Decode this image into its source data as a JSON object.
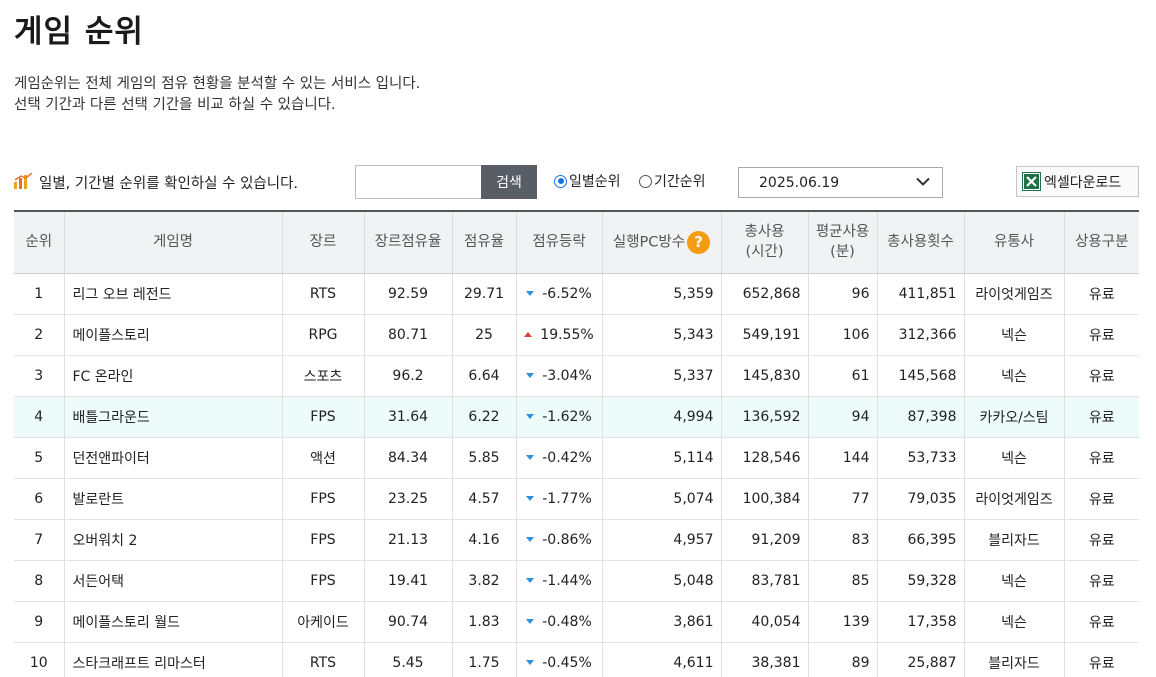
{
  "page": {
    "title": "게임 순위",
    "desc_line1": "게임순위는 전체 게임의 점유 현황을 분석할 수 있는 서비스 입니다.",
    "desc_line2": "선택 기간과 다른 선택 기간을 비교 하실 수 있습니다."
  },
  "toolbar": {
    "info_text": "일별, 기간별 순위를 확인하실 수 있습니다.",
    "search_value": "",
    "search_button": "검색",
    "radio_daily": "일별순위",
    "radio_period": "기간순위",
    "radio_selected": "daily",
    "date_value": "2025.06.19",
    "excel_button": "엑셀다운로드"
  },
  "colors": {
    "accent_blue": "#1a73e8",
    "up_red": "#e03a3a",
    "down_blue": "#2f8fd8",
    "help_orange": "#f39c12",
    "highlight_row": "#eefbfb"
  },
  "table": {
    "headers": {
      "rank": "순위",
      "name": "게임명",
      "genre": "장르",
      "genre_share": "장르점유율",
      "share": "점유율",
      "share_change": "점유등락",
      "pc_count": "실행PC방수",
      "total_usage_1": "총사용",
      "total_usage_2": "(시간)",
      "avg_usage_1": "평균사용",
      "avg_usage_2": "(분)",
      "total_count": "총사용횟수",
      "publisher": "유통사",
      "commercial": "상용구분"
    },
    "help_icon": "?",
    "rows": [
      {
        "rank": "1",
        "name": "리그 오브 레전드",
        "genre": "RTS",
        "genre_share": "92.59",
        "share": "29.71",
        "dir": "down",
        "change": "-6.52%",
        "pc": "5,359",
        "total": "652,868",
        "avg": "96",
        "count": "411,851",
        "publisher": "라이엇게임즈",
        "commercial": "유료"
      },
      {
        "rank": "2",
        "name": "메이플스토리",
        "genre": "RPG",
        "genre_share": "80.71",
        "share": "25",
        "dir": "up",
        "change": "19.55%",
        "pc": "5,343",
        "total": "549,191",
        "avg": "106",
        "count": "312,366",
        "publisher": "넥슨",
        "commercial": "유료"
      },
      {
        "rank": "3",
        "name": "FC 온라인",
        "genre": "스포츠",
        "genre_share": "96.2",
        "share": "6.64",
        "dir": "down",
        "change": "-3.04%",
        "pc": "5,337",
        "total": "145,830",
        "avg": "61",
        "count": "145,568",
        "publisher": "넥슨",
        "commercial": "유료"
      },
      {
        "rank": "4",
        "name": "배틀그라운드",
        "genre": "FPS",
        "genre_share": "31.64",
        "share": "6.22",
        "dir": "down",
        "change": "-1.62%",
        "pc": "4,994",
        "total": "136,592",
        "avg": "94",
        "count": "87,398",
        "publisher": "카카오/스팀",
        "commercial": "유료",
        "highlight": true
      },
      {
        "rank": "5",
        "name": "던전앤파이터",
        "genre": "액션",
        "genre_share": "84.34",
        "share": "5.85",
        "dir": "down",
        "change": "-0.42%",
        "pc": "5,114",
        "total": "128,546",
        "avg": "144",
        "count": "53,733",
        "publisher": "넥슨",
        "commercial": "유료"
      },
      {
        "rank": "6",
        "name": "발로란트",
        "genre": "FPS",
        "genre_share": "23.25",
        "share": "4.57",
        "dir": "down",
        "change": "-1.77%",
        "pc": "5,074",
        "total": "100,384",
        "avg": "77",
        "count": "79,035",
        "publisher": "라이엇게임즈",
        "commercial": "유료"
      },
      {
        "rank": "7",
        "name": "오버워치 2",
        "genre": "FPS",
        "genre_share": "21.13",
        "share": "4.16",
        "dir": "down",
        "change": "-0.86%",
        "pc": "4,957",
        "total": "91,209",
        "avg": "83",
        "count": "66,395",
        "publisher": "블리자드",
        "commercial": "유료"
      },
      {
        "rank": "8",
        "name": "서든어택",
        "genre": "FPS",
        "genre_share": "19.41",
        "share": "3.82",
        "dir": "down",
        "change": "-1.44%",
        "pc": "5,048",
        "total": "83,781",
        "avg": "85",
        "count": "59,328",
        "publisher": "넥슨",
        "commercial": "유료"
      },
      {
        "rank": "9",
        "name": "메이플스토리 월드",
        "genre": "아케이드",
        "genre_share": "90.74",
        "share": "1.83",
        "dir": "down",
        "change": "-0.48%",
        "pc": "3,861",
        "total": "40,054",
        "avg": "139",
        "count": "17,358",
        "publisher": "넥슨",
        "commercial": "유료"
      },
      {
        "rank": "10",
        "name": "스타크래프트 리마스터",
        "genre": "RTS",
        "genre_share": "5.45",
        "share": "1.75",
        "dir": "down",
        "change": "-0.45%",
        "pc": "4,611",
        "total": "38,381",
        "avg": "89",
        "count": "25,887",
        "publisher": "블리자드",
        "commercial": "유료"
      }
    ]
  }
}
